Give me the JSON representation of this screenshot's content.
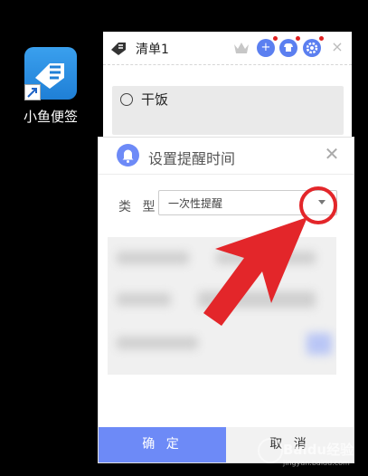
{
  "desktop": {
    "icon_label": "小鱼便签",
    "icon_name": "fish-note-app-icon"
  },
  "note": {
    "title": "清单1",
    "item_text": "干饭",
    "buttons": {
      "crown": "crown-icon",
      "add": "+",
      "skin": "shirt-icon",
      "settings": "gear-icon",
      "close": "×"
    }
  },
  "reminder_dialog": {
    "title": "设置提醒时间",
    "close": "✕",
    "type_label": "类 型",
    "type_value": "一次性提醒",
    "ok_label": "确 定",
    "cancel_label": "取 消"
  },
  "watermark": {
    "text": "Baidu经验",
    "sub": "jingyan.baidu.com"
  },
  "colors": {
    "accent": "#6d8af7",
    "annotation_red": "#e3262a",
    "desktop_bg": "#000000"
  }
}
